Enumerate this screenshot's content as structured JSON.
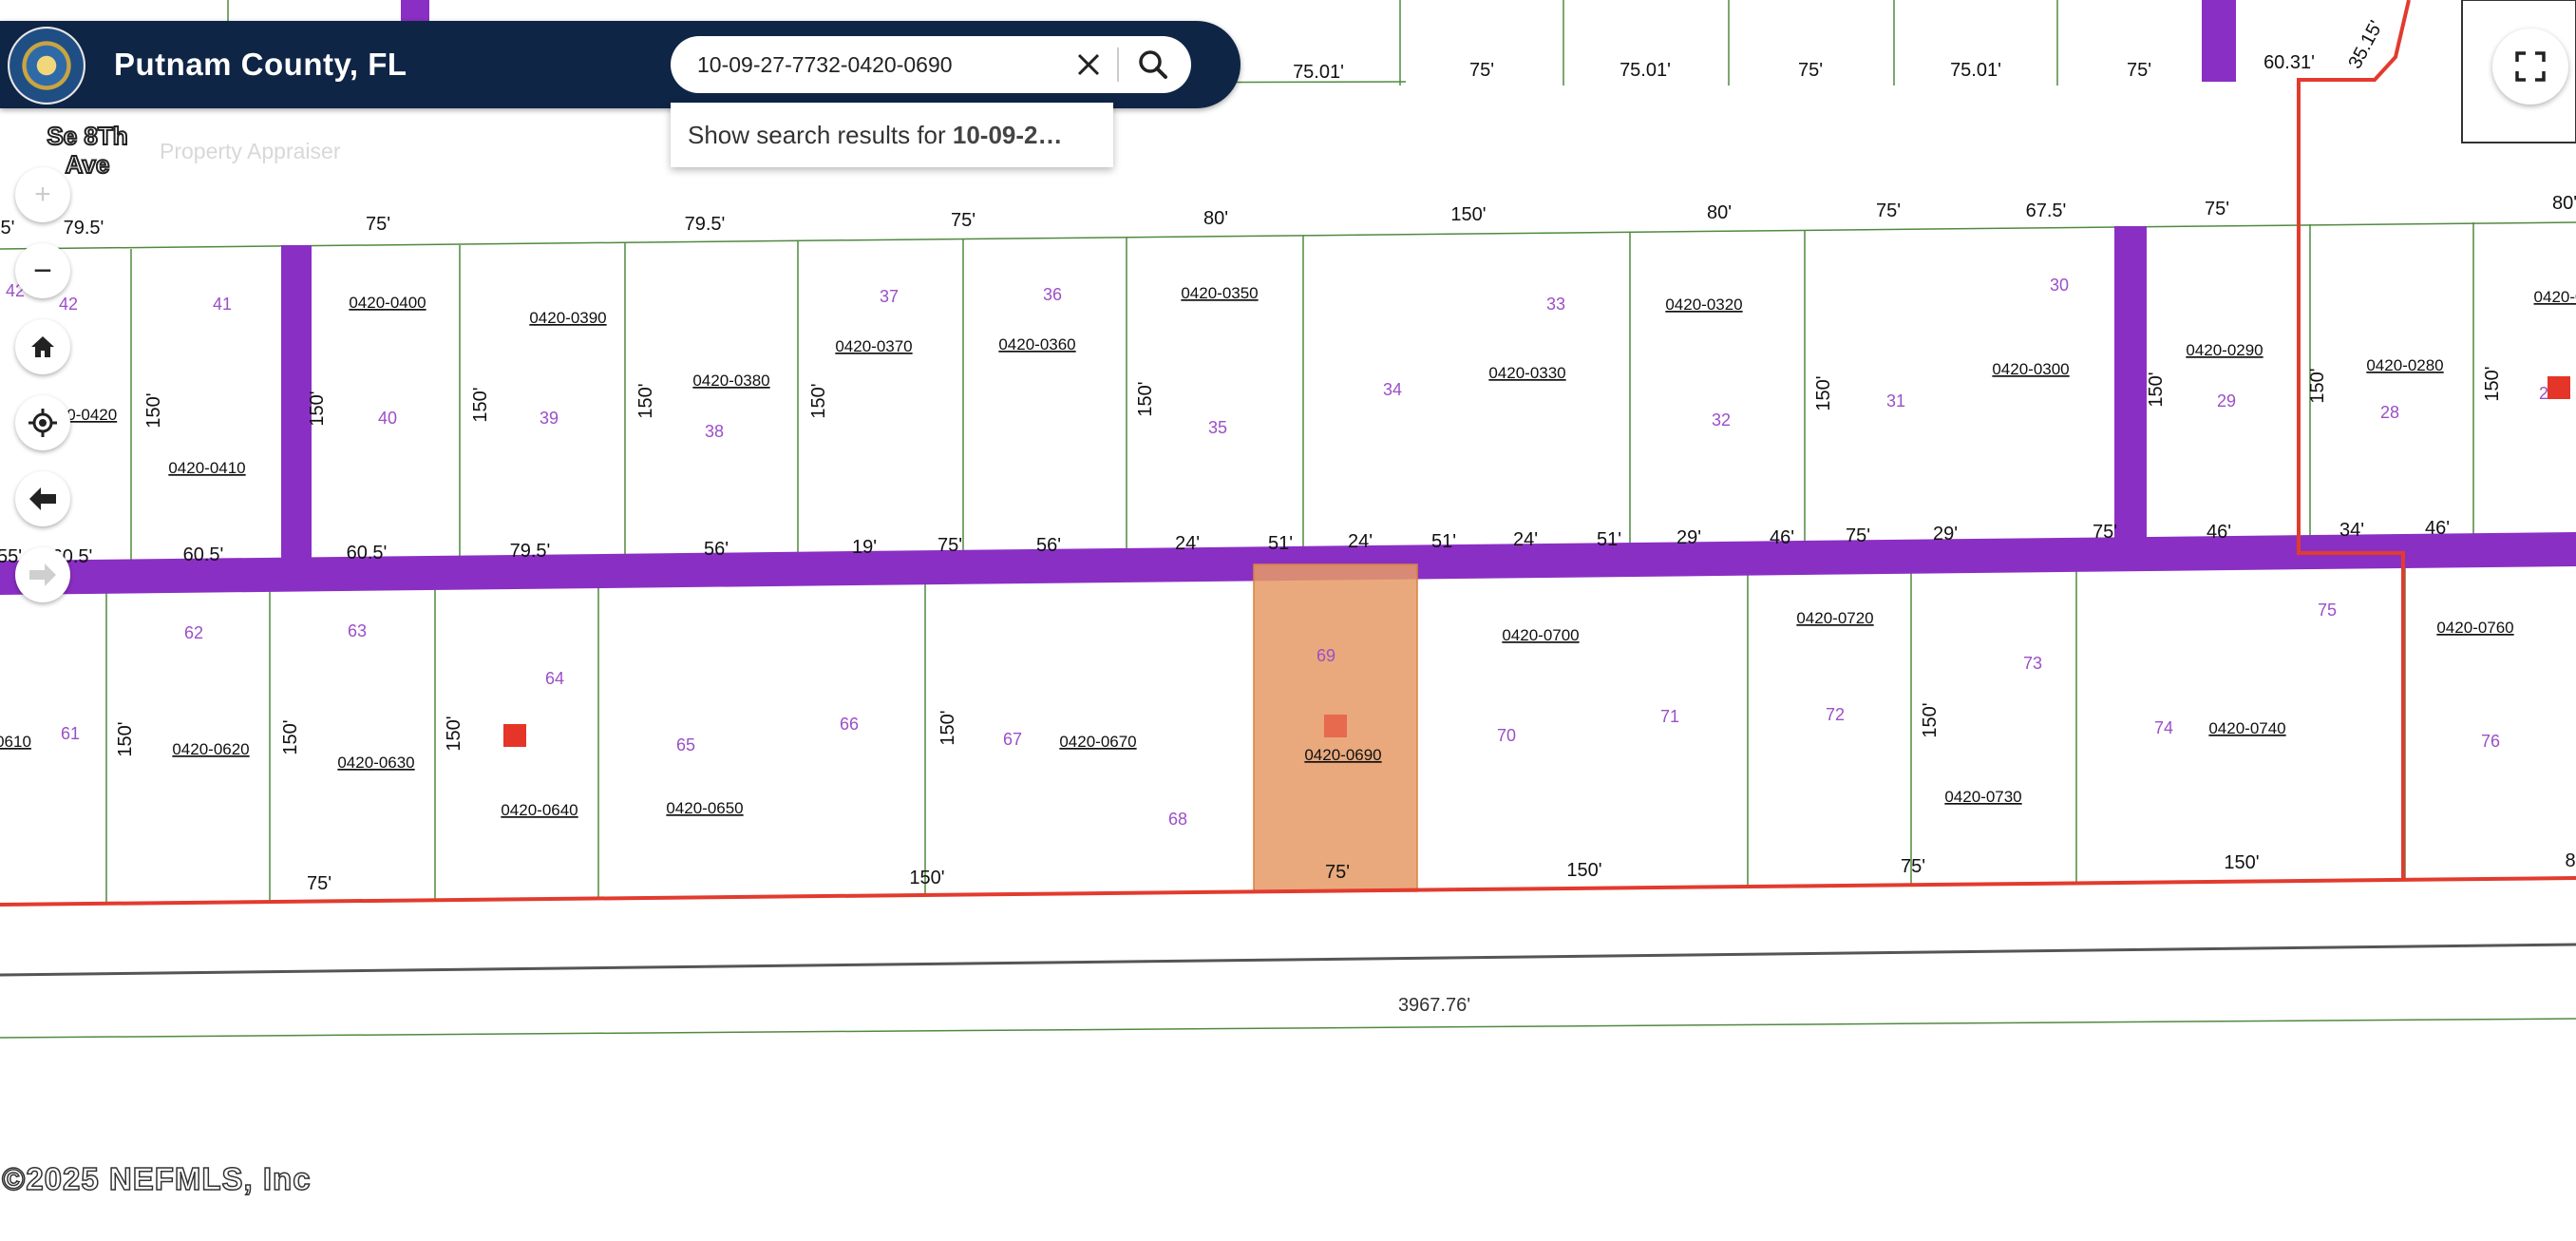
{
  "header": {
    "title": "Putnam County, FL"
  },
  "search": {
    "value": "10-09-27-7732-0420-0690",
    "suggestion_prefix": "Show search results for ",
    "suggestion_term": "10-09-2…"
  },
  "map": {
    "road_label": "Se 8Th Ave",
    "faded_label": "Property Appraiser",
    "copyright": "©2025 NEFMLS, Inc",
    "colors": {
      "road": "#8a2fc4",
      "boundary": "#e23b2e",
      "highlight": "#e59a66",
      "lot_line": "#4f8a3f",
      "marker": "#e53528"
    },
    "top_dims": [
      "75.01'",
      "75'",
      "75.01'",
      "75'",
      "75.01'",
      "75'",
      "60.31'",
      "35.15'"
    ],
    "row1_top_dims": [
      "5'",
      "79.5'",
      "75'",
      "79.5'",
      "75'",
      "80'",
      "150'",
      "80'",
      "75'",
      "67.5'",
      "75'",
      "80'"
    ],
    "row1_bottom_dims": [
      "55'",
      "60.5'",
      "60.5'",
      "60.5'",
      "79.5'",
      "56'",
      "19'",
      "75'",
      "56'",
      "24'",
      "51'",
      "24'",
      "51'",
      "24'",
      "51'",
      "29'",
      "46'",
      "75'",
      "29'",
      "75'",
      "46'",
      "34'",
      "46'"
    ],
    "row1_side_dims": [
      "150'",
      "150'",
      "150'",
      "150'",
      "150'",
      "150'",
      "150'",
      "150'",
      "150'",
      "150'"
    ],
    "row1_lots": [
      "42",
      "42",
      "41",
      "40",
      "39",
      "38",
      "37",
      "36",
      "35",
      "34",
      "33",
      "32",
      "31",
      "30",
      "29",
      "28",
      "2"
    ],
    "row1_parcels": [
      "20-0420",
      "0420-0410",
      "0420-0400",
      "0420-0390",
      "0420-0380",
      "0420-0370",
      "0420-0360",
      "0420-0350",
      "0420-0330",
      "0420-0320",
      "0420-0300",
      "0420-0290",
      "0420-0280",
      "0420-0"
    ],
    "row2_lots": [
      "61",
      "62",
      "63",
      "64",
      "65",
      "66",
      "67",
      "68",
      "69",
      "70",
      "71",
      "72",
      "73",
      "74",
      "75",
      "76"
    ],
    "row2_parcels": [
      "0610",
      "0420-0620",
      "0420-0630",
      "0420-0640",
      "0420-0650",
      "0420-0670",
      "0420-0690",
      "0420-0700",
      "0420-0720",
      "0420-0730",
      "0420-0740",
      "0420-0760"
    ],
    "row2_side_dims": [
      "150'",
      "150'",
      "150'",
      "150'",
      "150'"
    ],
    "row2_bottom_dims": [
      "75'",
      "150'",
      "75'",
      "150'",
      "75'",
      "150'",
      "8"
    ],
    "road_length": "3967.76'"
  },
  "controls": {
    "zoom_in": "+",
    "zoom_out": "−"
  }
}
